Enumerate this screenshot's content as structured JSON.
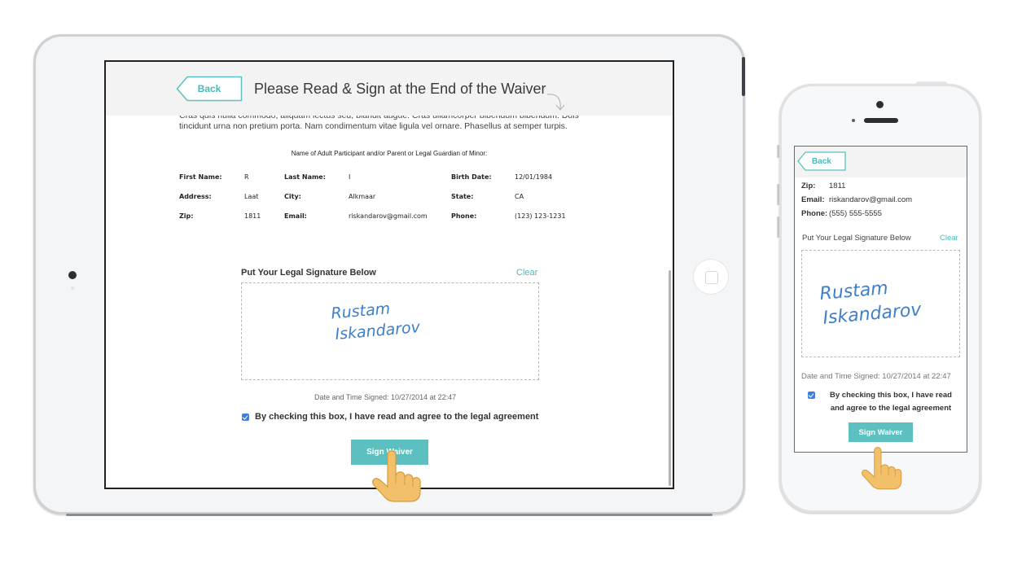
{
  "ipad": {
    "header": {
      "back_label": "Back",
      "title": "Please Read & Sign at the End of the Waiver"
    },
    "waiver_text": [
      "Cras quis nulla commodo, aliquam lectus sed, blandit augue. Cras ullamcorper bibendum bibendum. Duis",
      "tincidunt urna non pretium porta. Nam condimentum vitae ligula vel ornare. Phasellus at semper turpis."
    ],
    "participant_caption": "Name of Adult Participant and/or Parent or Legal Guardian of Minor:",
    "info_rows": [
      [
        {
          "label": "First Name:",
          "value": "R"
        },
        {
          "label": "Last Name:",
          "value": "I"
        },
        {
          "label": "Birth Date:",
          "value": "12/01/1984"
        }
      ],
      [
        {
          "label": "Address:",
          "value": "Laat"
        },
        {
          "label": "City:",
          "value": "Alkmaar"
        },
        {
          "label": "State:",
          "value": "CA"
        }
      ],
      [
        {
          "label": "Zip:",
          "value": "1811"
        },
        {
          "label": "Email:",
          "value": "riskandarov@gmail.com"
        },
        {
          "label": "Phone:",
          "value": "(123) 123-1231"
        }
      ]
    ],
    "signature": {
      "label": "Put Your Legal Signature Below",
      "clear_label": "Clear",
      "name_line1": "Rustam",
      "name_line2": "Iskandarov"
    },
    "date_signed": "Date and Time Signed:  10/27/2014 at 22:47",
    "agree_text": "By checking this box, I have read and agree to the legal agreement",
    "sign_button": "Sign Waiver"
  },
  "iphone": {
    "header": {
      "back_label": "Back"
    },
    "info": [
      {
        "label": "Zip:",
        "value": "1811"
      },
      {
        "label": "Email:",
        "value": "riskandarov@gmail.com"
      },
      {
        "label": "Phone:",
        "value": "(555) 555-5555"
      }
    ],
    "signature": {
      "label": "Put Your Legal Signature Below",
      "clear_label": "Clear",
      "name_line1": "Rustam",
      "name_line2": "Iskandarov"
    },
    "date_signed": "Date and Time Signed: 10/27/2014 at 22:47",
    "agree_line1": "By checking this box, I have read",
    "agree_line2": "and agree to the legal agreement",
    "sign_button": "Sign Waiver"
  },
  "colors": {
    "accent": "#5cc0c0",
    "accent_text": "#4db8b8",
    "signature_ink": "#3f7fc8",
    "checkbox": "#3d7fe0",
    "hand": "#f2bf6b"
  },
  "icons": [
    "back-tag-icon",
    "curved-arrow-icon",
    "pointing-hand-icon",
    "checkbox-checked-icon"
  ]
}
